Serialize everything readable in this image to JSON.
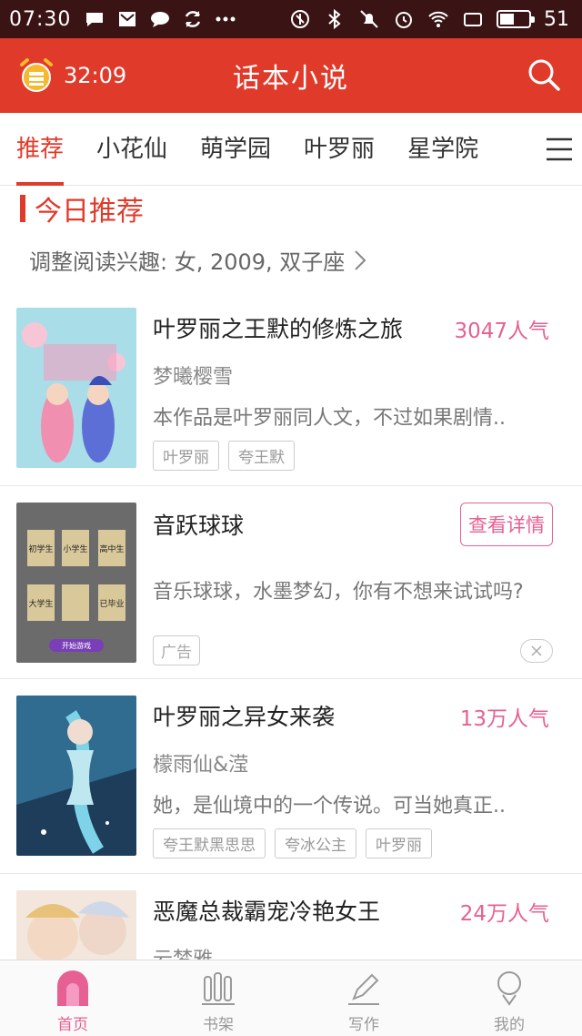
{
  "status_bar": {
    "time": "07:30",
    "left_icons": [
      "chat-bubble-icon",
      "mail-icon",
      "message-icon",
      "sync-icon",
      "more-icon"
    ],
    "right_icons": [
      "nfc-icon",
      "bluetooth-icon",
      "mute-icon",
      "alarm-icon",
      "wifi-icon",
      "screen-icon"
    ],
    "battery_level": 0.51,
    "battery_percent": "51"
  },
  "app_bar": {
    "timer": "32:09",
    "title": "话本小说",
    "accent": "#e03a2a"
  },
  "tabs": [
    {
      "label": "推荐",
      "active": true
    },
    {
      "label": "小花仙",
      "active": false
    },
    {
      "label": "萌学园",
      "active": false
    },
    {
      "label": "叶罗丽",
      "active": false
    },
    {
      "label": "星学院",
      "active": false
    }
  ],
  "section": {
    "title": "今日推荐",
    "interest": "调整阅读兴趣: 女, 2009, 双子座"
  },
  "books": [
    {
      "title": "叶罗丽之王默的修炼之旅",
      "popularity": "3047人气",
      "author": "梦曦樱雪",
      "description": "本作品是叶罗丽同人文，不过如果剧情..",
      "tags": [
        "叶罗丽",
        "夸王默"
      ]
    },
    {
      "title": "音跃球球",
      "detail_button": "查看详情",
      "description": "音乐球球，水墨梦幻，你有不想来试试吗?",
      "ad_label": "广告",
      "cover_texts": [
        "初学生",
        "小学生",
        "高中生",
        "大学生",
        "已毕业",
        "开始游戏"
      ]
    },
    {
      "title": "叶罗丽之异女来袭",
      "popularity": "13万人气",
      "author": "檬雨仙&滢",
      "description": "她，是仙境中的一个传说。可当她真正..",
      "tags": [
        "夸王默黑思思",
        "夸冰公主",
        "叶罗丽"
      ]
    },
    {
      "title": "恶魔总裁霸宠冷艳女王",
      "popularity": "24万人气",
      "author": "云梦雅"
    }
  ],
  "bottom_nav": [
    {
      "label": "首页",
      "icon": "home-icon",
      "active": true
    },
    {
      "label": "书架",
      "icon": "bookshelf-icon",
      "active": false
    },
    {
      "label": "写作",
      "icon": "pen-icon",
      "active": false
    },
    {
      "label": "我的",
      "icon": "profile-icon",
      "active": false
    }
  ],
  "colors": {
    "primary": "#e03a2a",
    "pink": "#e76093"
  }
}
